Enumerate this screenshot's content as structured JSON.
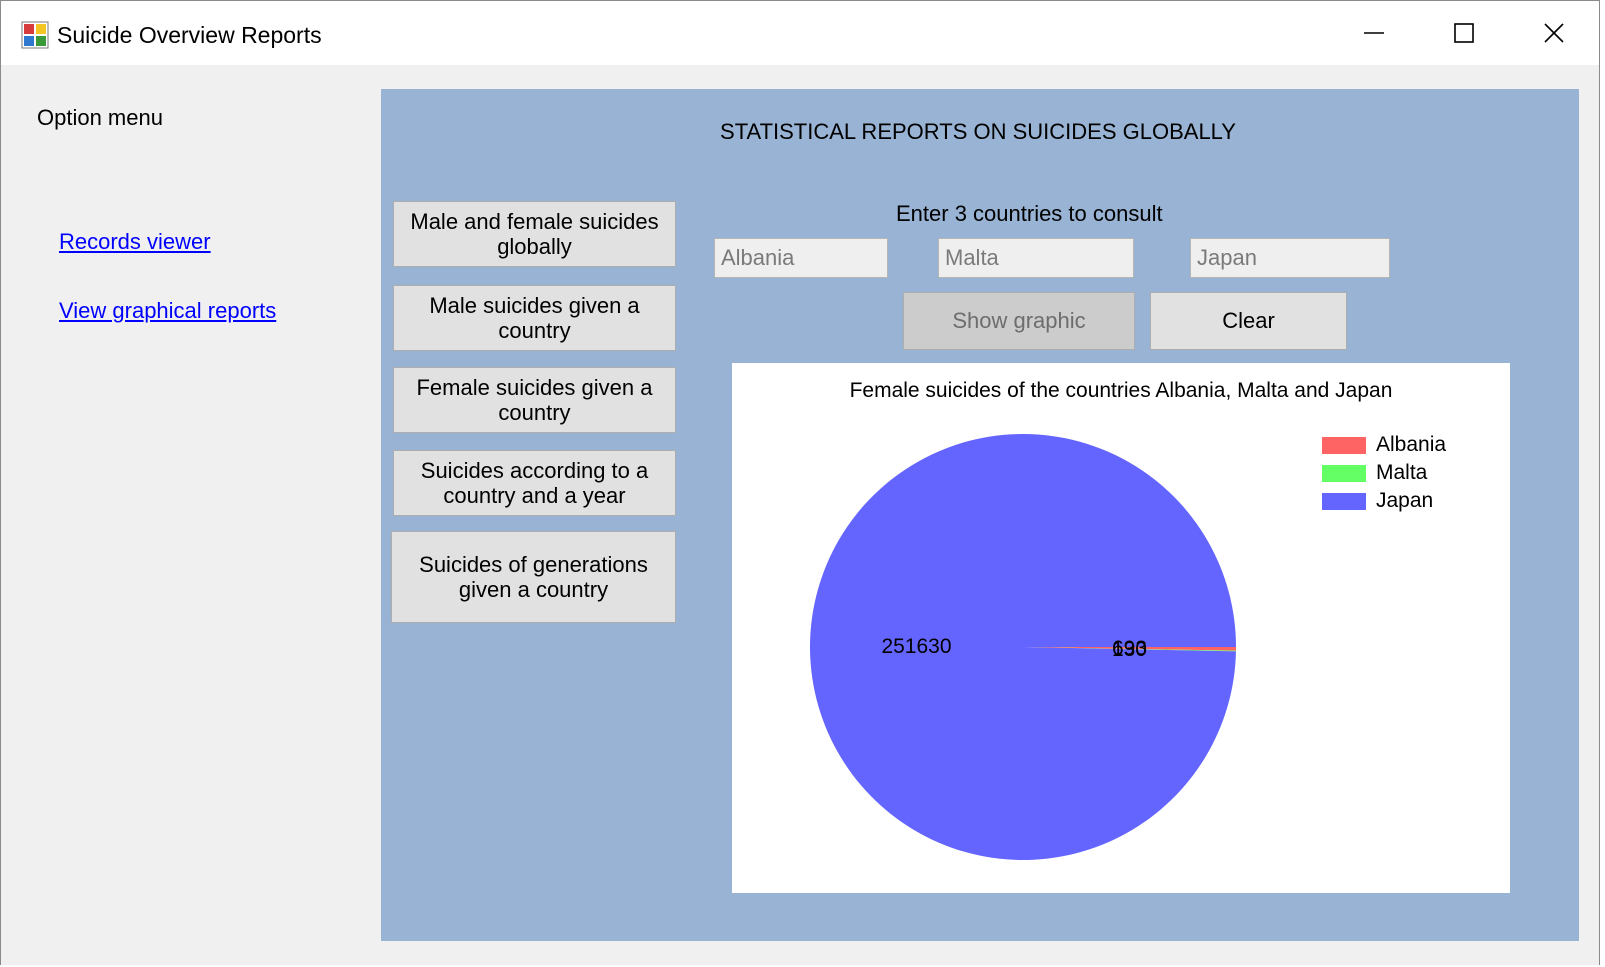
{
  "window": {
    "title": "Suicide Overview Reports",
    "controls": [
      "minimize-icon",
      "maximize-icon",
      "close-icon"
    ]
  },
  "sidebar": {
    "heading": "Option menu",
    "links": [
      {
        "label": "Records viewer"
      },
      {
        "label": "View graphical reports"
      }
    ]
  },
  "main": {
    "title": "STATISTICAL REPORTS ON SUICIDES GLOBALLY",
    "report_buttons": [
      {
        "line1": "Male and female suicides",
        "line2": "globally"
      },
      {
        "line1": "Male suicides given a",
        "line2": "country"
      },
      {
        "line1": "Female suicides given a",
        "line2": "country"
      },
      {
        "line1": "Suicides according to a",
        "line2": "country and a year"
      },
      {
        "line1": "Suicides of generations",
        "line2": "given a country"
      }
    ],
    "countries_prompt": "Enter 3 countries to consult",
    "inputs": [
      {
        "value": "Albania"
      },
      {
        "value": "Malta"
      },
      {
        "value": "Japan"
      }
    ],
    "show_graphic_label": "Show graphic",
    "clear_label": "Clear"
  },
  "chart_data": {
    "type": "pie",
    "title": "Female suicides of the countries Albania, Malta and Japan",
    "categories": [
      "Albania",
      "Malta",
      "Japan"
    ],
    "values": [
      693,
      130,
      251630
    ],
    "colors": [
      "#ff6464",
      "#64ff64",
      "#6464ff"
    ],
    "data_labels": [
      "693",
      "130",
      "251630"
    ],
    "legend_position": "top-right"
  }
}
